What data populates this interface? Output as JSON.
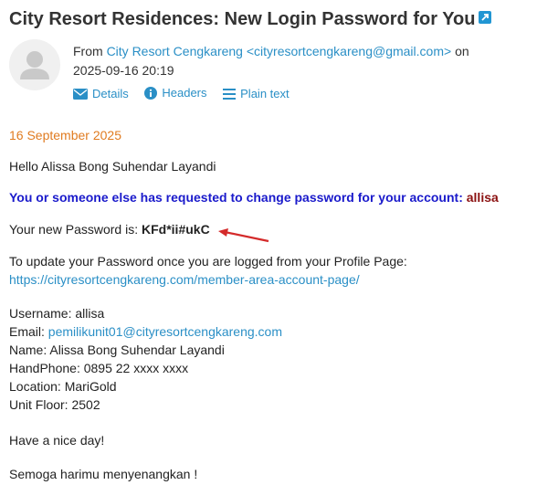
{
  "subject": "City Resort Residences: New Login Password for You",
  "header": {
    "from_prefix": "From",
    "sender": "City Resort Cengkareng <cityresortcengkareng@gmail.com>",
    "on_word": "on",
    "datetime": "2025-09-16 20:19",
    "links": {
      "details": "Details",
      "headers": "Headers",
      "plaintext": "Plain text"
    }
  },
  "body": {
    "date": "16 September 2025",
    "greeting": "Hello Alissa Bong Suhendar Layandi",
    "request_text": "You or someone else has requested to change password for your account:",
    "account": "allisa",
    "password_label": "Your new Password is:",
    "password": "KFd*ii#ukC",
    "update_text": "To update your Password once you are logged from your Profile Page:",
    "profile_url": "https://cityresortcengkareng.com/member-area-account-page/",
    "details": {
      "username_label": "Username:",
      "username": "allisa",
      "email_label": "Email:",
      "email": "pemilikunit01@cityresortcengkareng.com",
      "name_label": "Name:",
      "name": "Alissa Bong Suhendar Layandi",
      "phone_label": "HandPhone:",
      "phone": "0895 22 xxxx xxxx",
      "location_label": "Location:",
      "location": "MariGold",
      "unit_label": "Unit Floor:",
      "unit": "2502"
    },
    "closing": "Have a nice day!",
    "closing2": "Semoga harimu menyenangkan !"
  },
  "colors": {
    "link": "#2a8fc6",
    "date": "#e07b20",
    "emphasis": "#1a1acb",
    "account": "#8b1111",
    "arrow": "#d42a2a"
  }
}
